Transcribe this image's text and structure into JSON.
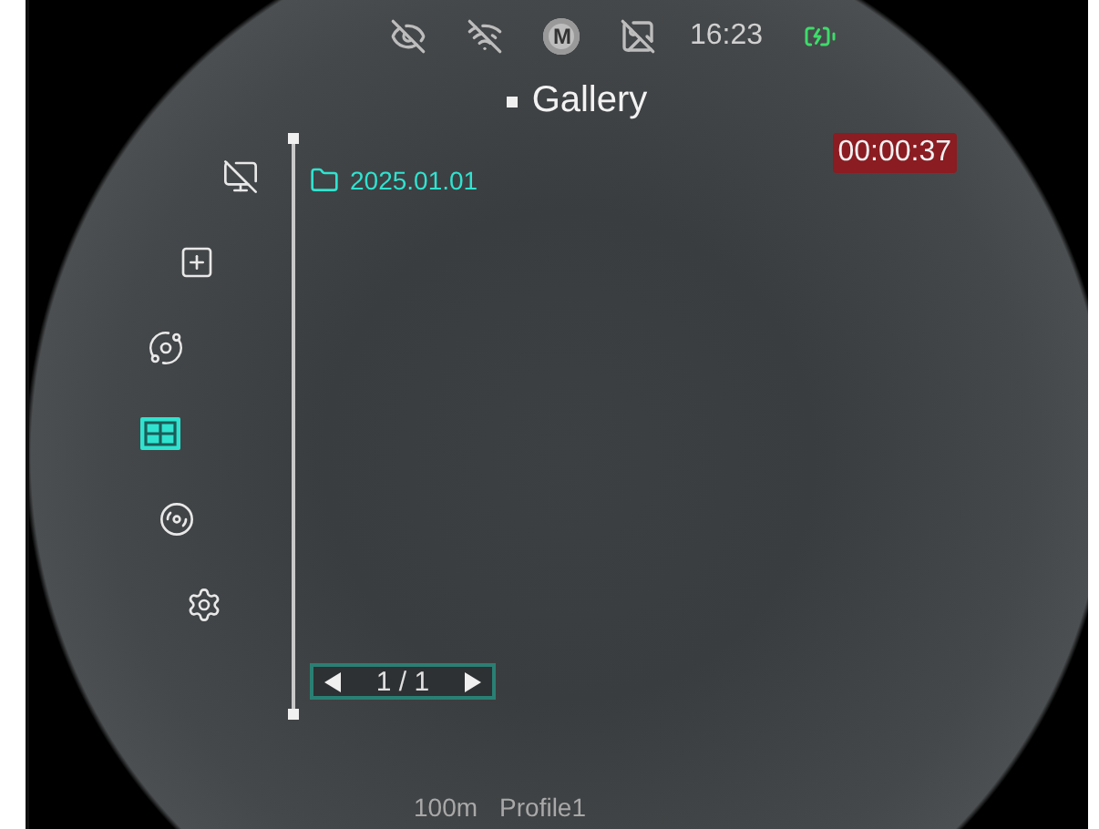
{
  "status_bar": {
    "mode_badge": "M",
    "time": "16:23",
    "charging": true
  },
  "title": "Gallery",
  "menu": [
    {
      "kind": "display-off",
      "selected": false
    },
    {
      "kind": "add",
      "selected": false
    },
    {
      "kind": "orbit",
      "selected": false
    },
    {
      "kind": "gallery",
      "selected": true
    },
    {
      "kind": "record",
      "selected": false
    },
    {
      "kind": "settings",
      "selected": false
    }
  ],
  "folders": [
    {
      "name": "2025.01.01"
    }
  ],
  "recording_timer": "00:00:37",
  "pager": {
    "text": "1 / 1"
  },
  "footer": {
    "distance": "100m",
    "profile": "Profile1"
  }
}
